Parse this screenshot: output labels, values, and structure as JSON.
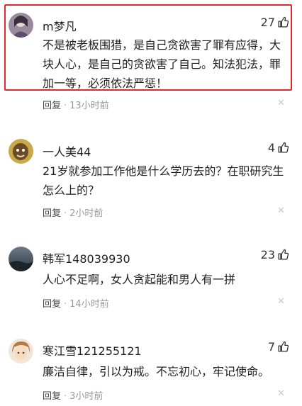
{
  "comments": [
    {
      "username": "m梦凡",
      "likes": "27",
      "text": "不是被老板围猎，是自己贪欲害了罪有应得，大块人心，是自己的贪欲害了自己。知法犯法，罪加一等，必须依法严惩！",
      "reply_label": "回复",
      "time": "13小时前",
      "highlighted": true
    },
    {
      "username": "一人美44",
      "likes": "4",
      "text": "21岁就参加工作他是什么学历去的？在职研究生怎么上的？",
      "reply_label": "回复",
      "time": "2小时前"
    },
    {
      "username": "韩军148039930",
      "likes": "23",
      "text": "人心不足啊，女人贪起能和男人有一拼",
      "reply_label": "回复",
      "time": "14小时前"
    },
    {
      "username": "寒江雪121255121",
      "likes": "7",
      "text": "廉洁自律，引以为戒。不忘初心，牢记使命。",
      "reply_label": "回复",
      "time": "3小时前"
    }
  ],
  "icons": {
    "like": "thumbs-up-icon",
    "dismiss": "close-icon"
  },
  "colors": {
    "highlight_border": "#e4262d",
    "meta_text": "#999999"
  }
}
